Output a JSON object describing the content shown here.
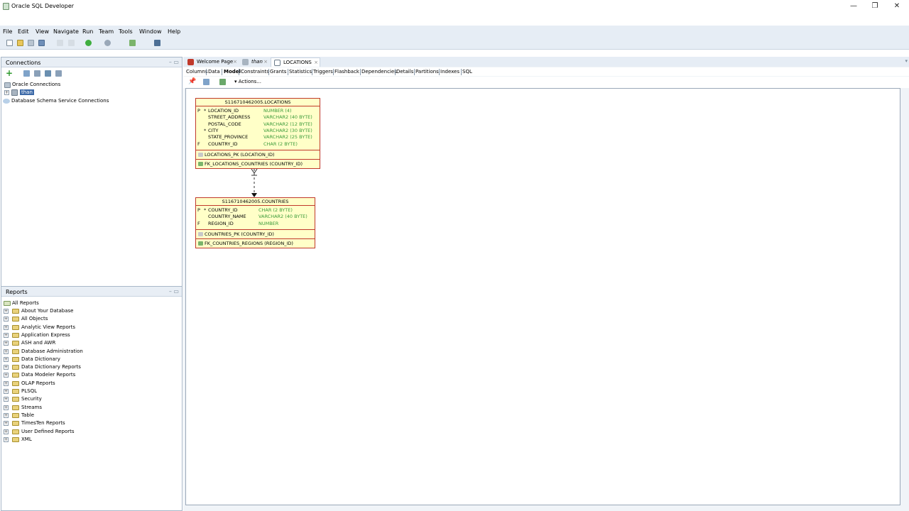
{
  "window": {
    "title": "Oracle SQL Developer",
    "controls": {
      "minimize": "—",
      "restore": "❐",
      "close": "✕"
    }
  },
  "menu": [
    "File",
    "Edit",
    "View",
    "Navigate",
    "Run",
    "Team",
    "Tools",
    "Window",
    "Help"
  ],
  "connections_pane": {
    "title": "Connections",
    "tree": [
      {
        "label": "Oracle Connections",
        "level": 0
      },
      {
        "label": "than",
        "level": 1,
        "selected": true
      },
      {
        "label": "Database Schema Service Connections",
        "level": 0
      }
    ]
  },
  "reports_pane": {
    "title": "Reports",
    "root": "All Reports",
    "items": [
      "About Your Database",
      "All Objects",
      "Analytic View Reports",
      "Application Express",
      "ASH and AWR",
      "Database Administration",
      "Data Dictionary",
      "Data Dictionary Reports",
      "Data Modeler Reports",
      "OLAP Reports",
      "PLSQL",
      "Security",
      "Streams",
      "Table",
      "TimesTen Reports",
      "User Defined Reports",
      "XML"
    ]
  },
  "editor": {
    "tabs": [
      {
        "label": "Welcome Page",
        "icon": "oracle-icon"
      },
      {
        "label": "than",
        "icon": "connection-icon",
        "italic": true
      },
      {
        "label": "LOCATIONS",
        "icon": "table-icon",
        "active": true
      }
    ],
    "subtabs": [
      "Columns",
      "Data",
      "Model",
      "Constraints",
      "Grants",
      "Statistics",
      "Triggers",
      "Flashback",
      "Dependencies",
      "Details",
      "Partitions",
      "Indexes",
      "SQL"
    ],
    "active_subtab": "Model",
    "actions_label": "Actions..."
  },
  "model": {
    "entities": [
      {
        "name": "S116710462005.LOCATIONS",
        "columns": [
          {
            "flag": "P",
            "mandatory": "*",
            "name": "LOCATION_ID",
            "type": "NUMBER (4)"
          },
          {
            "flag": "",
            "mandatory": "",
            "name": "STREET_ADDRESS",
            "type": "VARCHAR2 (40 BYTE)"
          },
          {
            "flag": "",
            "mandatory": "",
            "name": "POSTAL_CODE",
            "type": "VARCHAR2 (12 BYTE)"
          },
          {
            "flag": "",
            "mandatory": "*",
            "name": "CITY",
            "type": "VARCHAR2 (30 BYTE)"
          },
          {
            "flag": "",
            "mandatory": "",
            "name": "STATE_PROVINCE",
            "type": "VARCHAR2 (25 BYTE)"
          },
          {
            "flag": "F",
            "mandatory": "",
            "name": "COUNTRY_ID",
            "type": "CHAR (2 BYTE)"
          }
        ],
        "keys": [
          "LOCATIONS_PK (LOCATION_ID)",
          "FK_LOCATIONS_COUNTRIES (COUNTRY_ID)"
        ]
      },
      {
        "name": "S116710462005.COUNTRIES",
        "columns": [
          {
            "flag": "P",
            "mandatory": "*",
            "name": "COUNTRY_ID",
            "type": "CHAR (2 BYTE)"
          },
          {
            "flag": "",
            "mandatory": "",
            "name": "COUNTRY_NAME",
            "type": "VARCHAR2 (40 BYTE)"
          },
          {
            "flag": "F",
            "mandatory": "",
            "name": "REGION_ID",
            "type": "NUMBER"
          }
        ],
        "keys": [
          "COUNTRIES_PK (COUNTRY_ID)",
          "FK_COUNTRIES_REGIONS (REGION_ID)"
        ]
      }
    ]
  },
  "colors": {
    "entity_fill": "#ffffc8",
    "entity_border": "#c0392b",
    "type_text": "#3a9a3a"
  }
}
